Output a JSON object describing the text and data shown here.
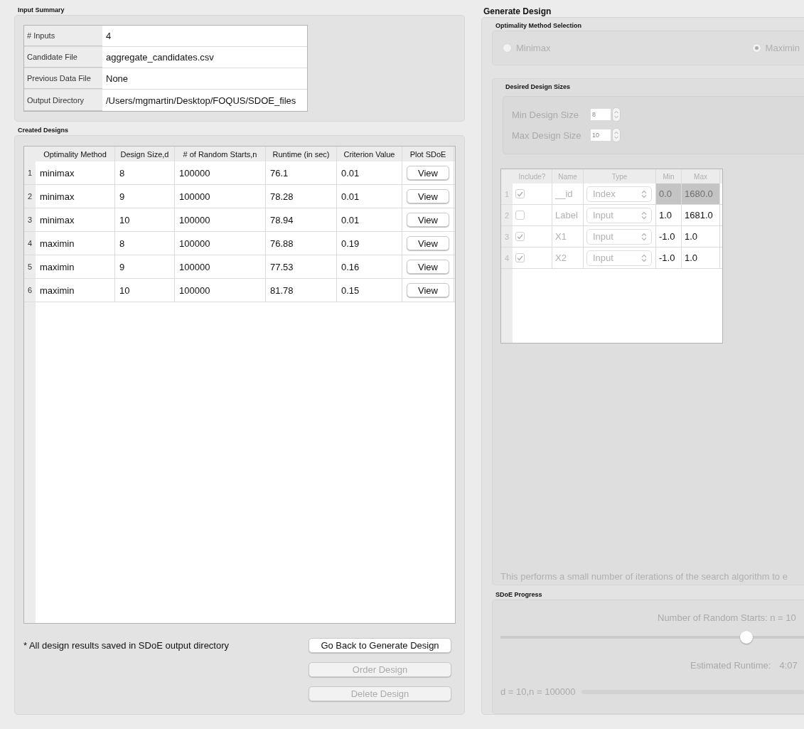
{
  "input_summary": {
    "title": "Input Summary",
    "rows": [
      {
        "label": "# Inputs",
        "value": "4"
      },
      {
        "label": "Candidate File",
        "value": "aggregate_candidates.csv"
      },
      {
        "label": "Previous Data File",
        "value": "None"
      },
      {
        "label": "Output Directory",
        "value": "/Users/mgmartin/Desktop/FOQUS/SDOE_files"
      }
    ]
  },
  "created_designs": {
    "title": "Created Designs",
    "columns": [
      "Optimality Method",
      "Design Size,d",
      "# of Random Starts,n",
      "Runtime (in sec)",
      "Criterion Value",
      "Plot SDoE"
    ],
    "rows": [
      {
        "index": "1",
        "method": "minimax",
        "size": "8",
        "starts": "100000",
        "runtime": "76.1",
        "criterion": "0.01",
        "action": "View"
      },
      {
        "index": "2",
        "method": "minimax",
        "size": "9",
        "starts": "100000",
        "runtime": "78.28",
        "criterion": "0.01",
        "action": "View"
      },
      {
        "index": "3",
        "method": "minimax",
        "size": "10",
        "starts": "100000",
        "runtime": "78.94",
        "criterion": "0.01",
        "action": "View"
      },
      {
        "index": "4",
        "method": "maximin",
        "size": "8",
        "starts": "100000",
        "runtime": "76.88",
        "criterion": "0.19",
        "action": "View"
      },
      {
        "index": "5",
        "method": "maximin",
        "size": "9",
        "starts": "100000",
        "runtime": "77.53",
        "criterion": "0.16",
        "action": "View"
      },
      {
        "index": "6",
        "method": "maximin",
        "size": "10",
        "starts": "100000",
        "runtime": "81.78",
        "criterion": "0.15",
        "action": "View"
      }
    ],
    "note": "* All design results saved in SDoE output directory",
    "buttons": [
      {
        "label": "Go Back to Generate Design",
        "disabled": false
      },
      {
        "label": "Order Design",
        "disabled": true
      },
      {
        "label": "Delete Design",
        "disabled": true
      }
    ]
  },
  "generate_design": {
    "title": "Generate Design",
    "optimality": {
      "title": "Optimality Method Selection",
      "options": [
        {
          "label": "Minimax",
          "selected": false
        },
        {
          "label": "Maximin",
          "selected": true
        }
      ]
    },
    "sizes": {
      "title": "Desired Design Sizes",
      "fields": [
        {
          "label": "Min Design Size",
          "value": "8"
        },
        {
          "label": "Max Design Size",
          "value": "10"
        }
      ]
    },
    "inputs_table": {
      "columns": [
        "Include?",
        "Name",
        "Type",
        "Min",
        "Max"
      ],
      "rows": [
        {
          "index": "1",
          "include": true,
          "name": "__id",
          "type": "Index",
          "min": "0.0",
          "max": "1680.0",
          "locked": true
        },
        {
          "index": "2",
          "include": false,
          "name": "Label",
          "type": "Input",
          "min": "1.0",
          "max": "1681.0",
          "locked": false
        },
        {
          "index": "3",
          "include": true,
          "name": "X1",
          "type": "Input",
          "min": "-1.0",
          "max": "1.0",
          "locked": false
        },
        {
          "index": "4",
          "include": true,
          "name": "X2",
          "type": "Input",
          "min": "-1.0",
          "max": "1.0",
          "locked": false
        }
      ]
    },
    "hint": "This performs a small number of iterations of the search algorithm to e",
    "progress": {
      "title": "SDoE Progress",
      "starts_label": "Number of Random Starts: n = 10",
      "slider": {
        "level": 0.81
      },
      "runtime_label": "Estimated Runtime:",
      "runtime_value": "4:07",
      "progress_label": "d = 10,n = 100000",
      "progress_bar": {
        "level": 0
      }
    }
  }
}
